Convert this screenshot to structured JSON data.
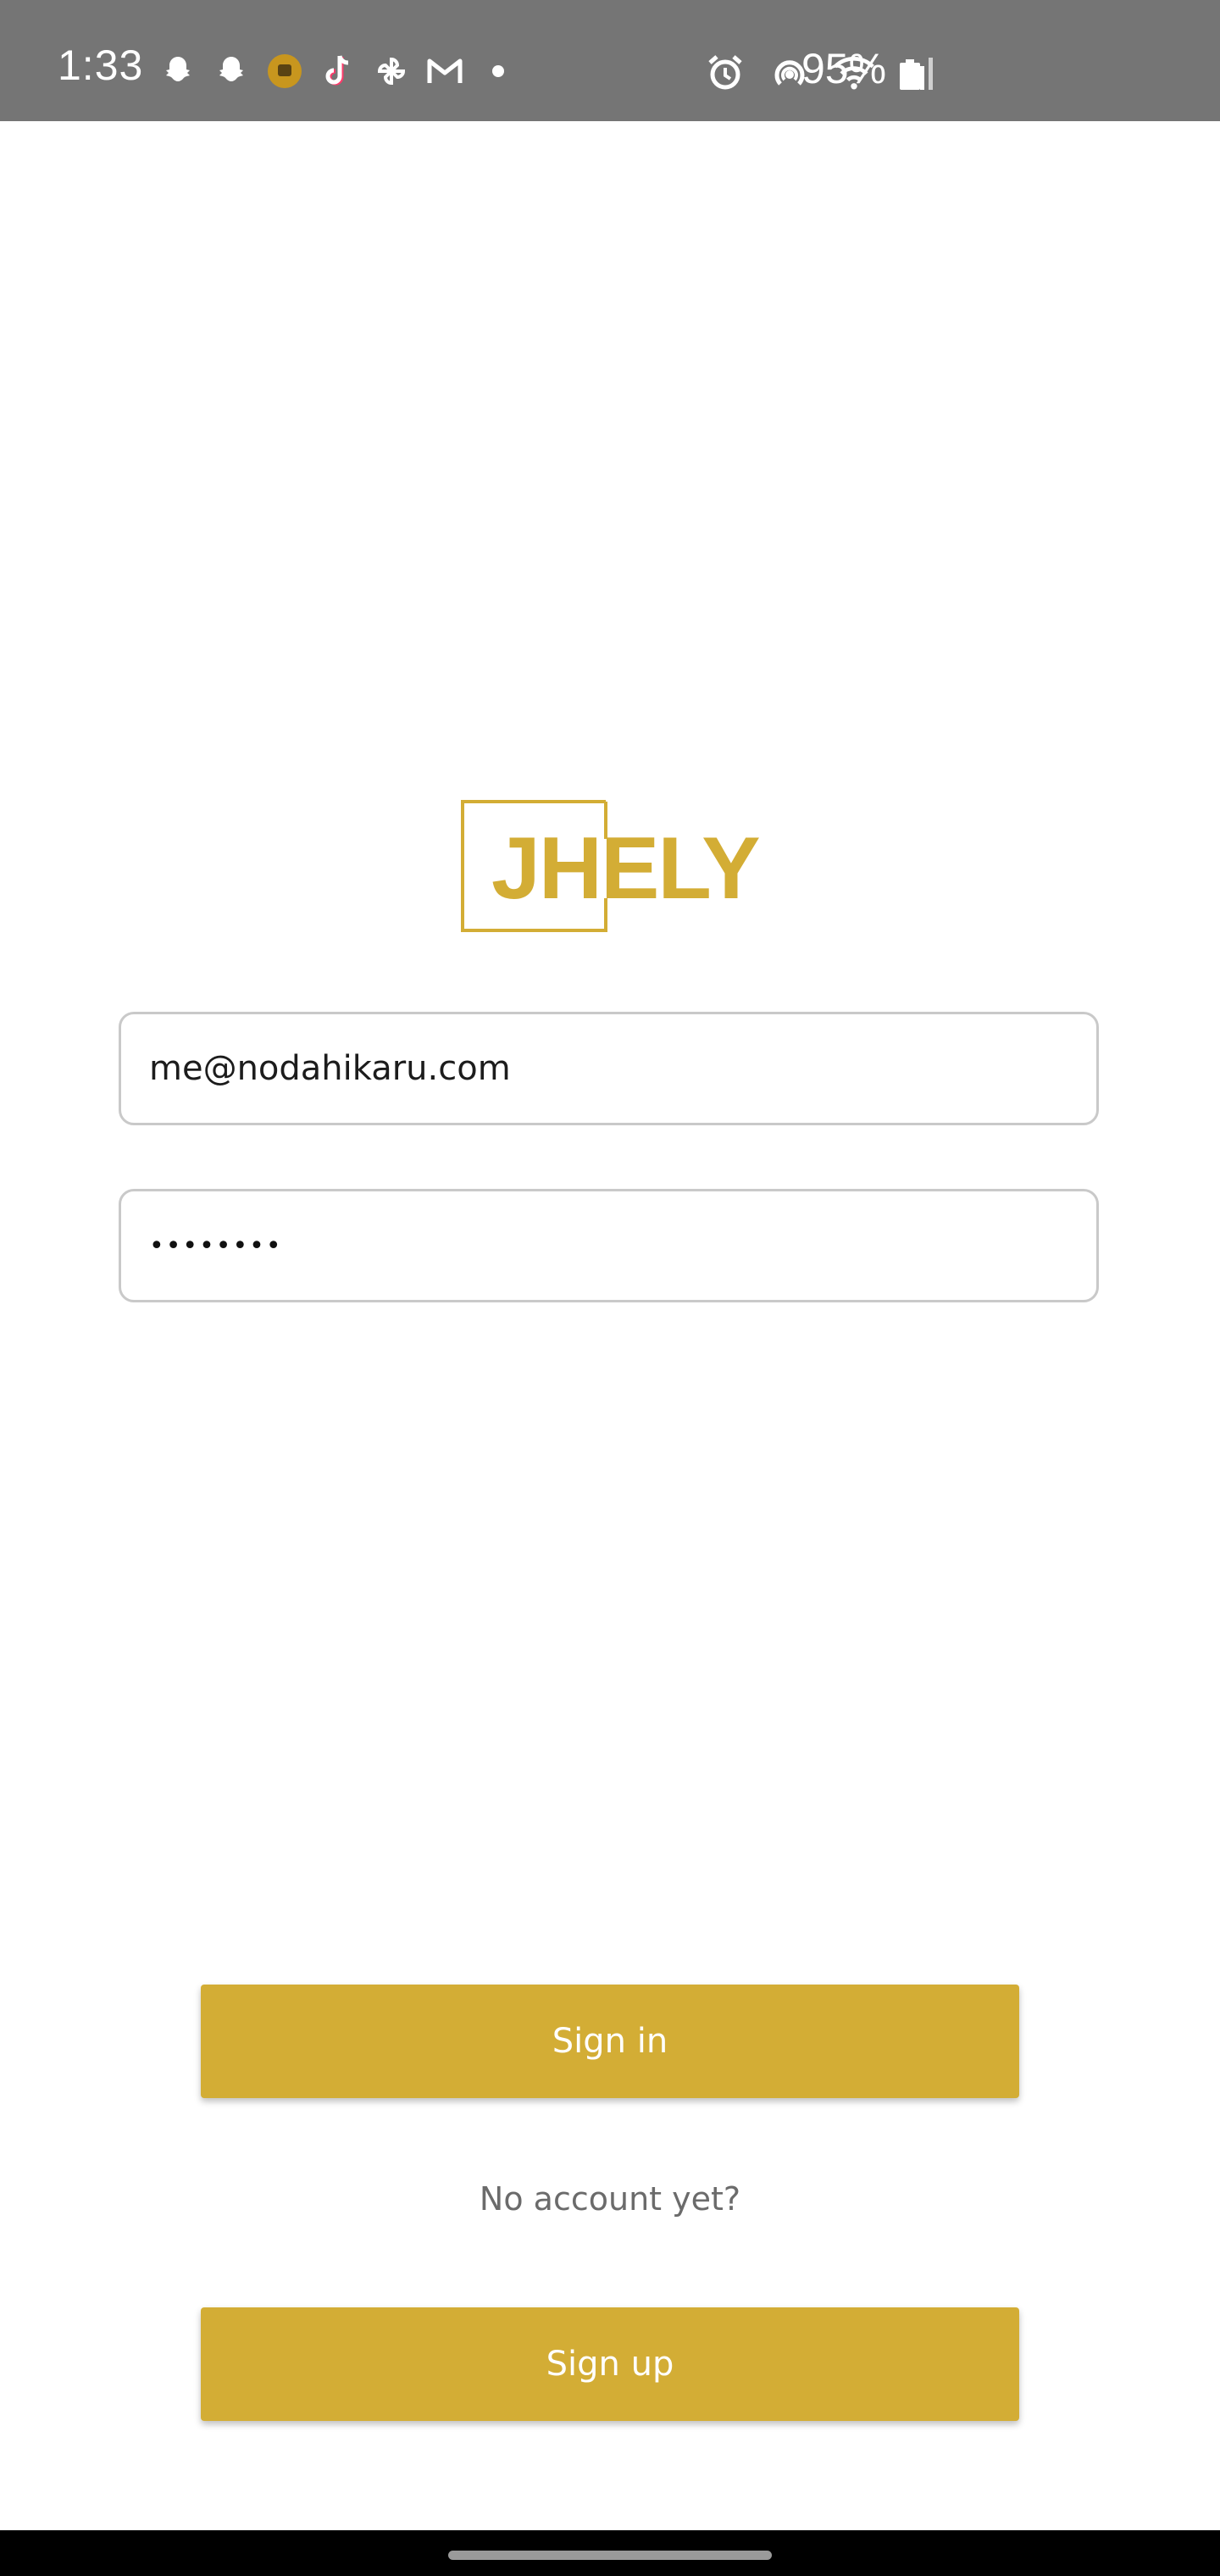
{
  "status_bar": {
    "time": "1:33",
    "battery_percent": "95%",
    "background_color": "#757575",
    "left_icons": [
      "snapchat-icon",
      "snapchat-icon",
      "app-icon",
      "tiktok-icon",
      "pinwheel-icon",
      "gmail-icon",
      "dot-icon"
    ],
    "right_icons": [
      "alarm-icon",
      "hotspot-icon",
      "wifi-icon",
      "signal-icon",
      "battery-icon"
    ]
  },
  "logo": {
    "text": "JHELY",
    "color": "#d3ad35"
  },
  "login_form": {
    "email_value": "me@nodahikaru.com",
    "password_mask": "••••••••"
  },
  "actions": {
    "signin_label": "Sign in",
    "no_account_text": "No account yet?",
    "signup_label": "Sign up",
    "button_color": "#d3ad35"
  }
}
